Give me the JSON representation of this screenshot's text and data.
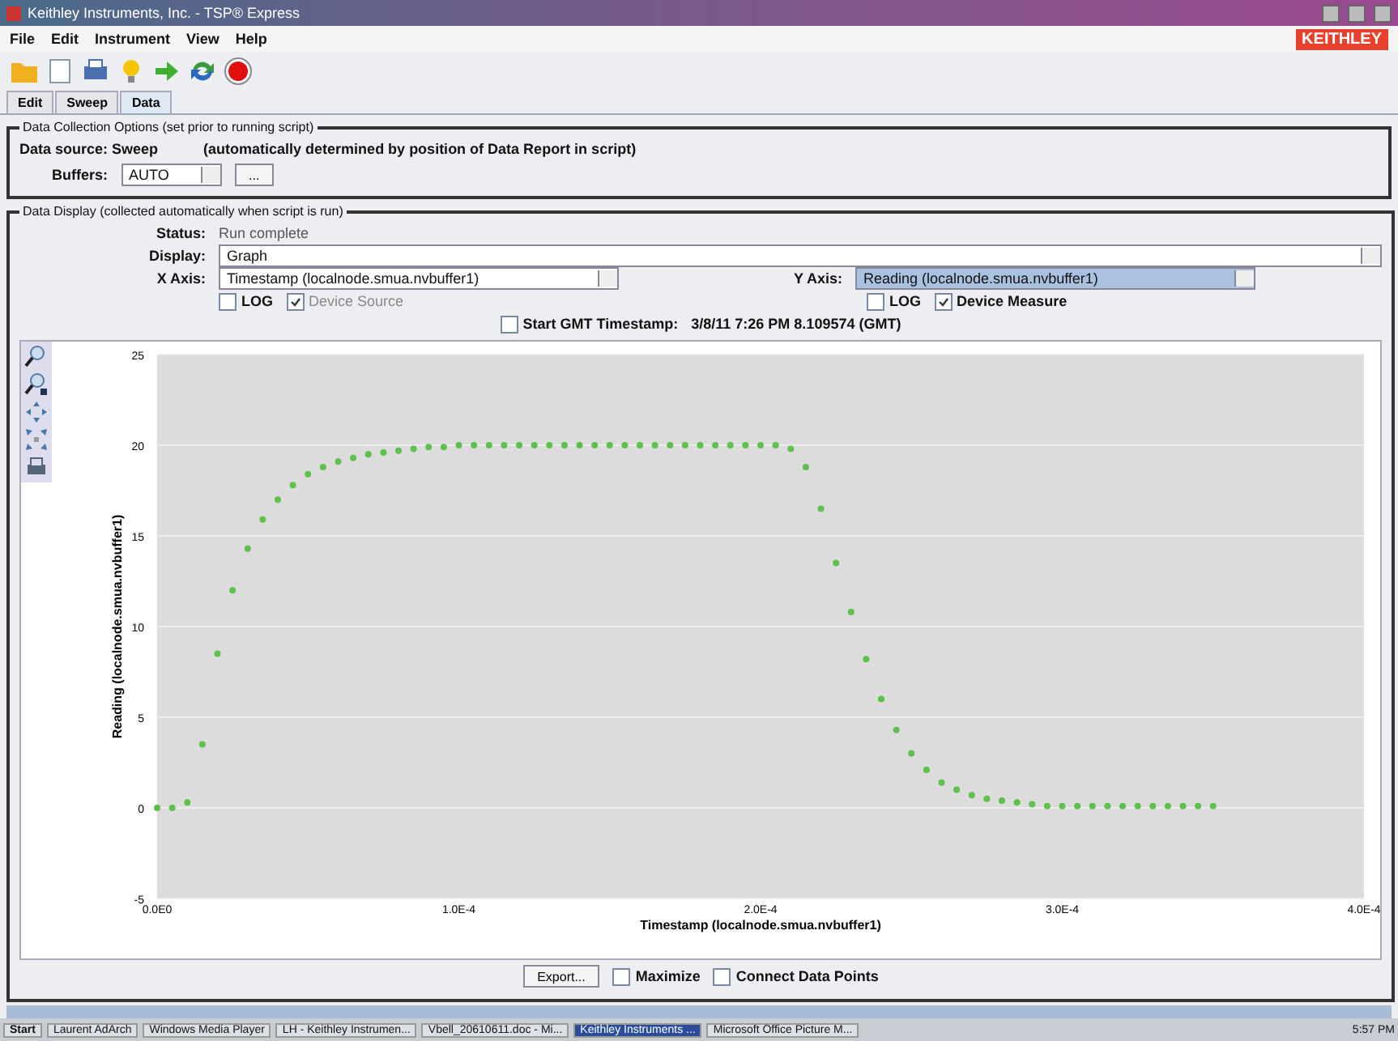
{
  "window": {
    "title": "Keithley Instruments, Inc. - TSP® Express"
  },
  "logo": "KEITHLEY",
  "menu": [
    "File",
    "Edit",
    "Instrument",
    "View",
    "Help"
  ],
  "tabs": [
    {
      "label": "Edit",
      "selected": false
    },
    {
      "label": "Sweep",
      "selected": false
    },
    {
      "label": "Data",
      "selected": true
    }
  ],
  "collection": {
    "title": "Data Collection Options (set prior to running script)",
    "source": "Data source: Sweep",
    "source_note": "(automatically determined by position of Data Report in script)",
    "buffers_label": "Buffers:",
    "buffers_value": "AUTO",
    "browse_button": "..."
  },
  "display": {
    "title": "Data Display (collected automatically when script is run)",
    "status_label": "Status:",
    "status": "Run complete",
    "display_label": "Display:",
    "display_value": "Graph",
    "x_axis": {
      "label": "X Axis:",
      "value": "Timestamp (localnode.smua.nvbuffer1)",
      "selected": false
    },
    "y_axis": {
      "label": "Y Axis:",
      "value": "Reading (localnode.smua.nvbuffer1)",
      "selected": true
    },
    "x_options": [
      {
        "label": "LOG",
        "checked": false,
        "disabled": false
      },
      {
        "label": "Device Source",
        "checked": true,
        "disabled": true
      }
    ],
    "y_options": [
      {
        "label": "LOG",
        "checked": false,
        "disabled": false
      },
      {
        "label": "Device Measure",
        "checked": true,
        "disabled": false
      }
    ],
    "gmt": {
      "label": "Start GMT Timestamp:",
      "checked": false,
      "value": "3/8/11 7:26 PM 8.109574 (GMT)"
    },
    "chart_data": {
      "type": "scatter",
      "xlabel": "Timestamp (localnode.smua.nvbuffer1)",
      "ylabel": "Reading (localnode.smua.nvbuffer1)",
      "xlim": [
        0,
        0.0004
      ],
      "ylim": [
        -5,
        25
      ],
      "xticks": [
        {
          "value": 0,
          "label": "0.0E0"
        },
        {
          "value": 0.0001,
          "label": "1.0E-4"
        },
        {
          "value": 0.0002,
          "label": "2.0E-4"
        },
        {
          "value": 0.0003,
          "label": "3.0E-4"
        },
        {
          "value": 0.0004,
          "label": "4.0E-4"
        }
      ],
      "yticks": [
        -5,
        0,
        5,
        10,
        15,
        20,
        25
      ],
      "x": [
        0,
        5e-06,
        1e-05,
        1.5e-05,
        2e-05,
        2.5e-05,
        3e-05,
        3.5e-05,
        4e-05,
        4.5e-05,
        5e-05,
        5.5e-05,
        6e-05,
        6.5e-05,
        7e-05,
        7.5e-05,
        8e-05,
        8.5e-05,
        9e-05,
        9.5e-05,
        0.0001,
        0.000105,
        0.00011,
        0.000115,
        0.00012,
        0.000125,
        0.00013,
        0.000135,
        0.00014,
        0.000145,
        0.00015,
        0.000155,
        0.00016,
        0.000165,
        0.00017,
        0.000175,
        0.00018,
        0.000185,
        0.00019,
        0.000195,
        0.0002,
        0.000205,
        0.00021,
        0.000215,
        0.00022,
        0.000225,
        0.00023,
        0.000235,
        0.00024,
        0.000245,
        0.00025,
        0.000255,
        0.00026,
        0.000265,
        0.00027,
        0.000275,
        0.00028,
        0.000285,
        0.00029,
        0.000295,
        0.0003,
        0.000305,
        0.00031,
        0.000315,
        0.00032,
        0.000325,
        0.00033,
        0.000335,
        0.00034,
        0.000345,
        0.00035
      ],
      "grid": true,
      "series": [
        {
          "color": "#5cc24a",
          "values": [
            0,
            0,
            0.3,
            3.5,
            8.5,
            12,
            14.3,
            15.9,
            17,
            17.8,
            18.4,
            18.8,
            19.1,
            19.3,
            19.5,
            19.6,
            19.7,
            19.8,
            19.9,
            19.9,
            20,
            20,
            20,
            20,
            20,
            20,
            20,
            20,
            20,
            20,
            20,
            20,
            20,
            20,
            20,
            20,
            20,
            20,
            20,
            20,
            20,
            20,
            19.8,
            18.8,
            16.5,
            13.5,
            10.8,
            8.2,
            6,
            4.3,
            3,
            2.1,
            1.4,
            1,
            0.7,
            0.5,
            0.4,
            0.3,
            0.2,
            0.1,
            0.1,
            0.1,
            0.1,
            0.1,
            0.1,
            0.1,
            0.1,
            0.1,
            0.1,
            0.1,
            0.1
          ]
        }
      ]
    },
    "export_button": "Export...",
    "footer_options": [
      {
        "label": "Maximize",
        "checked": false
      },
      {
        "label": "Connect Data Points",
        "checked": false
      }
    ]
  },
  "taskbar": {
    "start": "Start",
    "items": [
      {
        "label": "Laurent AdArch",
        "selected": false
      },
      {
        "label": "Windows Media Player",
        "selected": false
      },
      {
        "label": "LH - Keithley Instrumen...",
        "selected": false
      },
      {
        "label": "Vbell_20610611.doc - Mi...",
        "selected": false
      },
      {
        "label": "Keithley Instruments ...",
        "selected": true
      },
      {
        "label": "Microsoft Office Picture M...",
        "selected": false
      }
    ],
    "clock": "5:57 PM"
  }
}
